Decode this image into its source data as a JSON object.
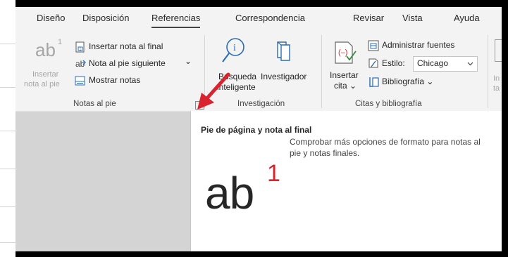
{
  "tabs": [
    "Diseño",
    "Disposición",
    "Referencias",
    "Correspondencia",
    "Revisar",
    "Vista",
    "Ayuda"
  ],
  "active_tab": "Referencias",
  "footnotes": {
    "insert_label_line1": "Insertar",
    "insert_label_line2": "nota al pie",
    "ab_glyph": "ab",
    "sup_glyph": "1",
    "insert_endnote": "Insertar nota al final",
    "next_footnote": "Nota al pie siguiente",
    "next_footnote_chevron": "⌄",
    "show_notes": "Mostrar notas",
    "group_label": "Notas al pie"
  },
  "research": {
    "search_line1": "Búsqueda",
    "search_line2": "inteligente",
    "researcher": "Investigador",
    "group_label": "Investigación"
  },
  "citations": {
    "insert_line1": "Insertar",
    "insert_line2": "cita ⌄",
    "manage_sources": "Administrar fuentes",
    "style_label": "Estilo:",
    "style_value": "Chicago",
    "bibliography": "Bibliografía ⌄",
    "group_label": "Citas y bibliografía"
  },
  "clipped": {
    "right_top": "In",
    "right_bottom": "ta"
  },
  "tooltip": {
    "title": "Pie de página y nota al final",
    "description": "Comprobar más opciones de formato para notas al pie y notas finales.",
    "ab": "ab",
    "sup": "1"
  },
  "colors": {
    "accent_red": "#d9232e",
    "icon_blue": "#2b6cb0"
  }
}
